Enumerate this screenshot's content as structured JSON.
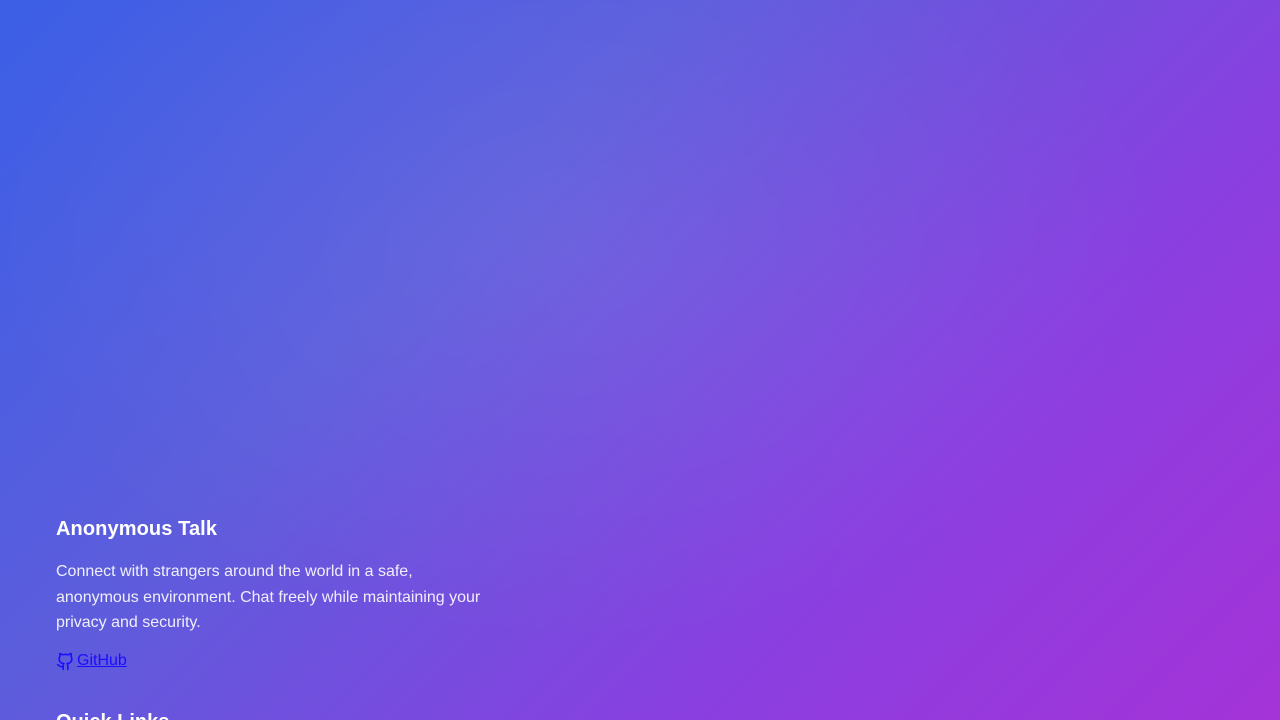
{
  "footer": {
    "brand_title": "Anonymous Talk",
    "brand_description": "Connect with strangers around the world in a safe, anonymous environment. Chat freely while maintaining your privacy and security.",
    "github_label": "GitHub",
    "github_icon": "github-icon",
    "quick_links_title": "Quick Links"
  },
  "colors": {
    "gradient_start": "#3b5fe6",
    "gradient_end": "#a433d8",
    "link": "#1a0dff"
  }
}
